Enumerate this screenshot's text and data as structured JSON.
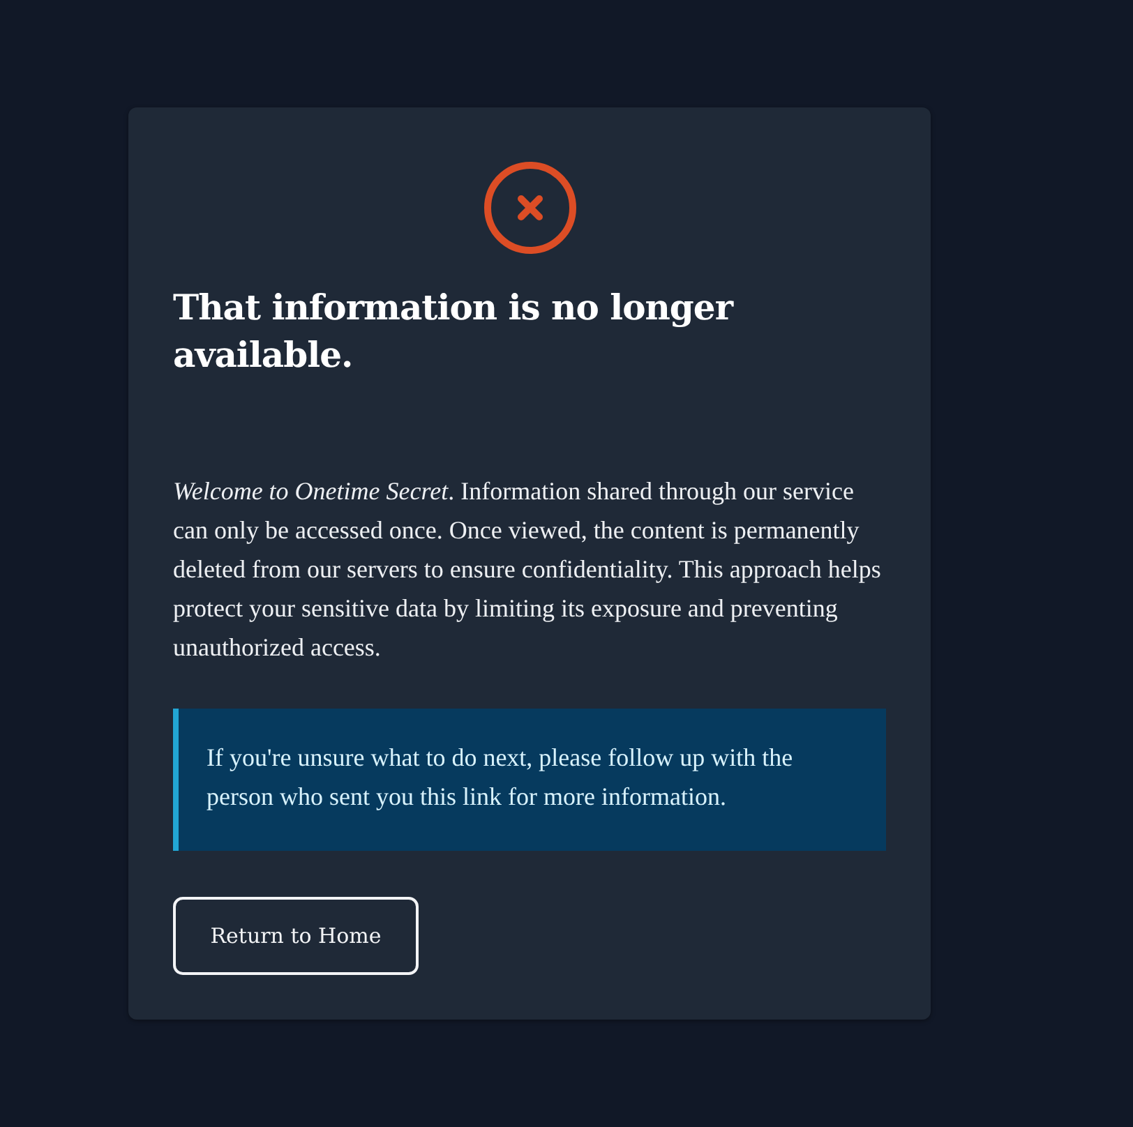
{
  "card": {
    "heading": "That information is no longer available.",
    "message": "*Welcome to Onetime Secret*. Information shared through our service can only be accessed once. Once viewed, the content is permanently deleted from our servers to ensure confidentiality. This approach helps protect your sensitive data by limiting its exposure and preventing unauthorized access.",
    "notice": "If you're unsure what to do next, please follow up with the person who sent you this link for more information.",
    "button": "Return to Home"
  }
}
